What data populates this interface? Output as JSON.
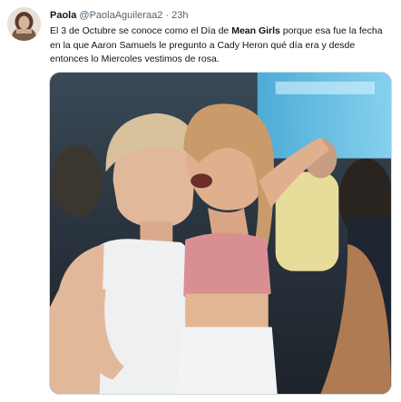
{
  "tweet": {
    "display_name": "Paola",
    "handle": "@PaolaAguileraa2",
    "separator": "·",
    "time": "23h",
    "text_part1": "El 3 de Octubre se conoce como el Día de ",
    "text_bold": "Mean Girls",
    "text_part2": " porque esa fue la fecha en la que Aaron Samuels le pregunto a Cady Heron qué día era y desde entonces lo Miercoles vestimos de rosa."
  },
  "colors": {
    "text_primary": "#0f1419",
    "text_secondary": "#536471",
    "media_border": "#cfd9de"
  },
  "icons": {
    "avatar": "profile-photo"
  }
}
